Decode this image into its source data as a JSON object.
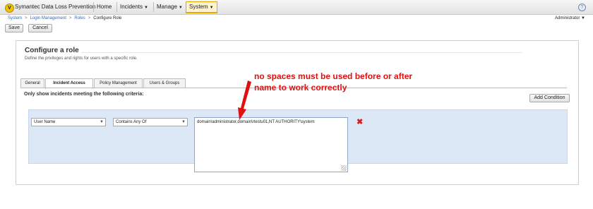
{
  "header": {
    "app_title": "Symantec Data Loss Prevention",
    "logo_letter": "V",
    "nav": [
      "Home",
      "Incidents",
      "Manage",
      "System"
    ],
    "active_nav": "System",
    "help_glyph": "?"
  },
  "breadcrumb": [
    "System",
    "Login Management",
    "Roles",
    "Configure Role"
  ],
  "user_menu": "Administrator",
  "toolbar": {
    "save_label": "Save",
    "cancel_label": "Cancel"
  },
  "page": {
    "title": "Configure a role",
    "subtitle": "Define the privileges and rights for users with a specific role."
  },
  "tabs": [
    "General",
    "Incident Access",
    "Policy Management",
    "Users & Groups"
  ],
  "active_tab": "Incident Access",
  "criteria_label": "Only show incidents meeting the following criteria:",
  "add_condition_label": "Add Condition",
  "condition": {
    "field": "User Name",
    "operator": "Contains Any Of",
    "value": "domain\\administrator,domain\\rtestu01,NT AUTHORITY\\system"
  },
  "annotation": {
    "line1": "no spaces must be used before or after",
    "line2": "name to work correctly",
    "color": "#e01010",
    "highlight_color": "#ffff00"
  },
  "icons": {
    "remove": "close-x-icon",
    "dropdown": "chevron-down-icon",
    "help": "help-icon"
  }
}
